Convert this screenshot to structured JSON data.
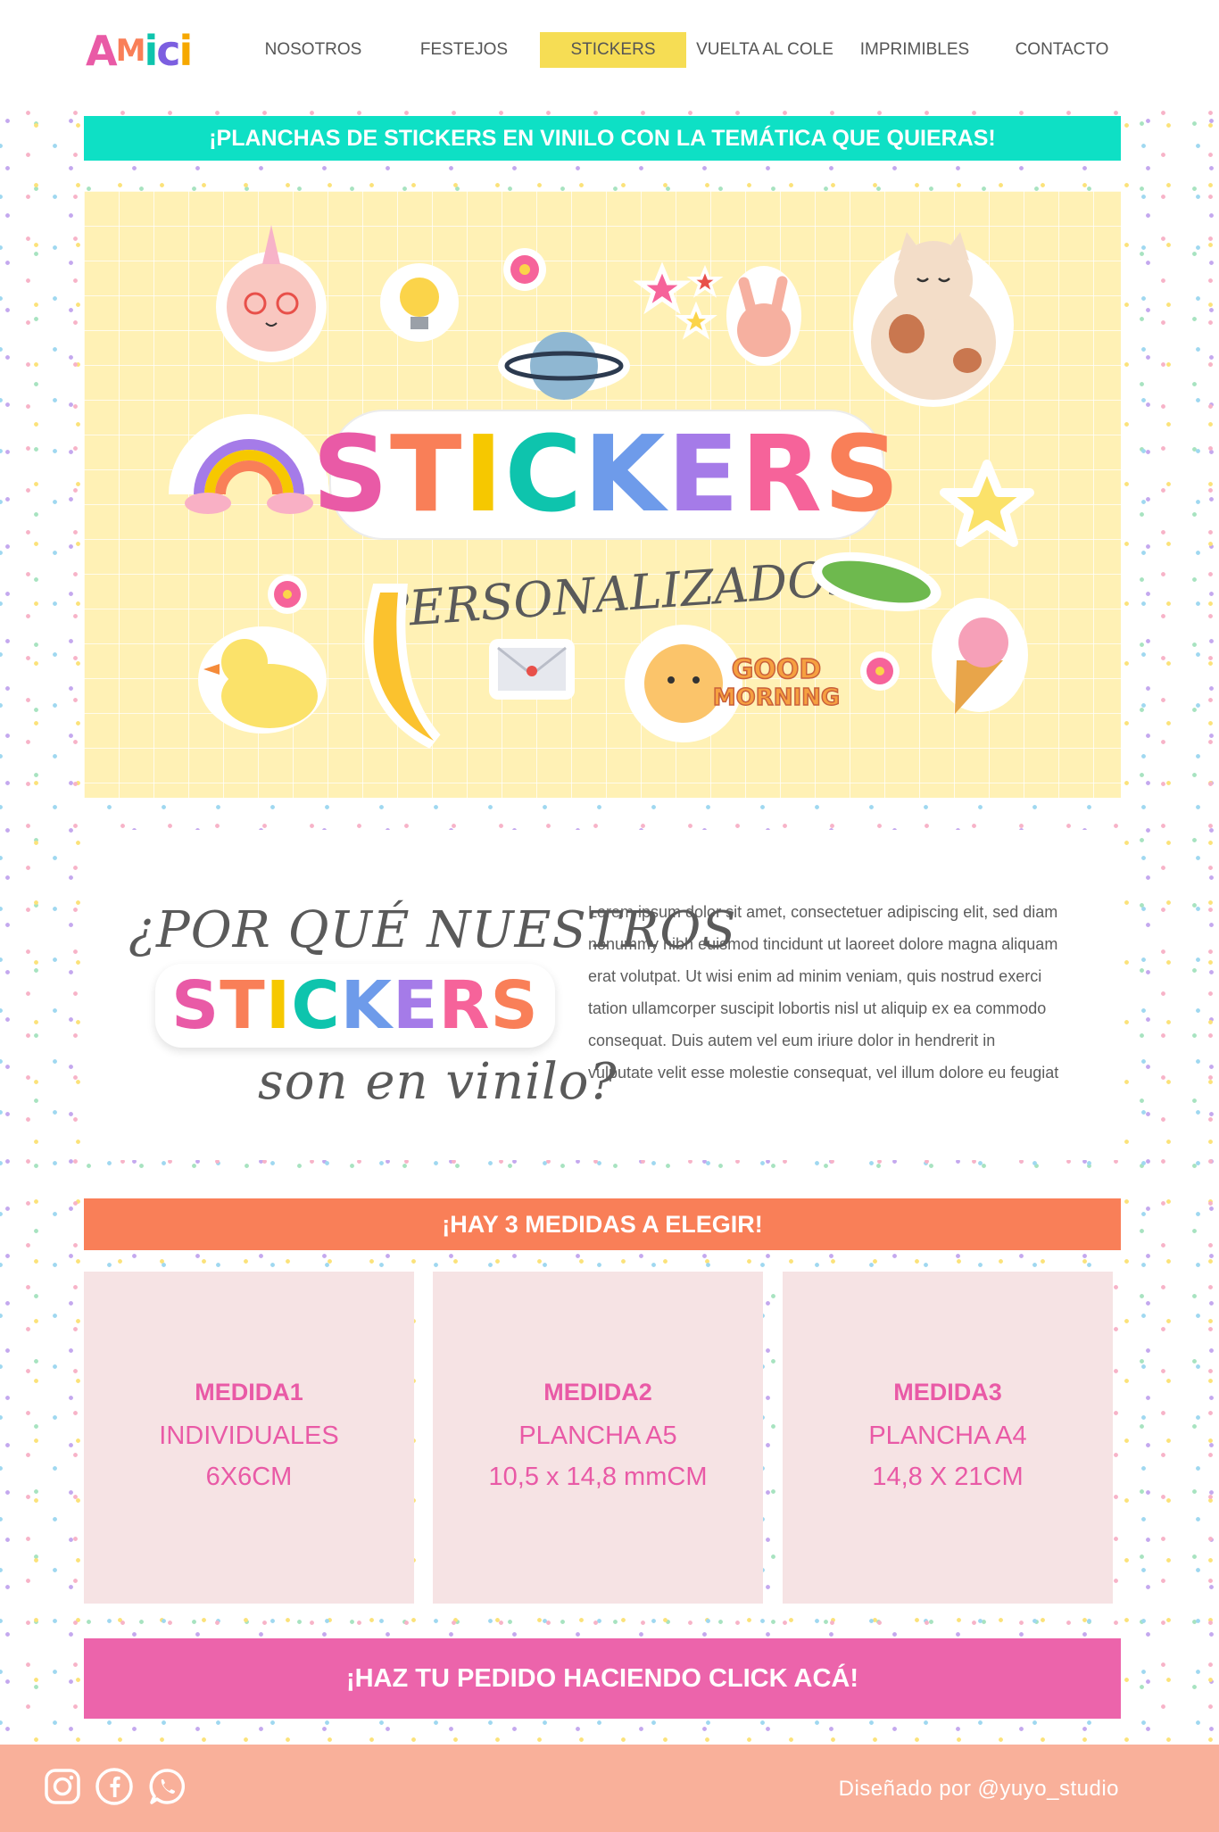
{
  "brand": {
    "logo_letters": [
      "A",
      "M",
      "i",
      "c",
      "i"
    ],
    "logo_colors": [
      "#e95aa6",
      "#f97f58",
      "#0ec4ad",
      "#7c5fe0",
      "#f6a800"
    ]
  },
  "nav": {
    "items": [
      {
        "label": "NOSOTROS"
      },
      {
        "label": "FESTEJOS"
      },
      {
        "label": "STICKERS",
        "active": true
      },
      {
        "label": "VUELTA AL COLE"
      },
      {
        "label": "IMPRIMIBLES"
      },
      {
        "label": "CONTACTO"
      }
    ]
  },
  "top_banner": {
    "text": "¡PLANCHAS DE STICKERS EN VINILO CON LA TEMÁTICA QUE QUIERAS!"
  },
  "hero": {
    "title_letters": [
      "S",
      "T",
      "I",
      "C",
      "K",
      "E",
      "R",
      "S"
    ],
    "title_colors": [
      "#e95aa6",
      "#f97f58",
      "#f6c800",
      "#0ec4ad",
      "#6e9bea",
      "#a57be8",
      "#f6639a",
      "#f97f58"
    ],
    "subtitle": "PERSONALIZADOS",
    "sticker_caption_line1": "GOOD",
    "sticker_caption_line2": "MORNING"
  },
  "why": {
    "question_start": "¿POR QUÉ NUESTROS",
    "question_word": "STICKERS",
    "question_end": "son en vinilo?",
    "body": "Lorem ipsum dolor sit amet, consectetuer adipiscing elit, sed diam nonummy nibh euismod tincidunt ut laoreet dolore magna aliquam erat volutpat. Ut wisi enim ad minim veniam, quis nostrud exerci tation ullamcorper suscipit lobortis nisl ut aliquip ex ea commodo consequat. Duis autem vel eum iriure dolor in hendrerit in vulputate velit esse molestie consequat, vel illum dolore eu feugiat"
  },
  "sizes_banner": {
    "text": "¡HAY 3 MEDIDAS A ELEGIR!"
  },
  "sizes": [
    {
      "title": "MEDIDA1",
      "line1": "INDIVIDUALES",
      "line2": "6X6CM"
    },
    {
      "title": "MEDIDA2",
      "line1": "PLANCHA A5",
      "line2": "10,5 x 14,8 mmCM"
    },
    {
      "title": "MEDIDA3",
      "line1": "PLANCHA A4",
      "line2": "14,8 X 21CM"
    }
  ],
  "cta": {
    "text": "¡HAZ TU PEDIDO HACIENDO CLICK ACÁ!"
  },
  "footer": {
    "credit": "Diseñado por @yuyo_studio",
    "social_icons": [
      "instagram-icon",
      "facebook-icon",
      "whatsapp-icon"
    ]
  }
}
